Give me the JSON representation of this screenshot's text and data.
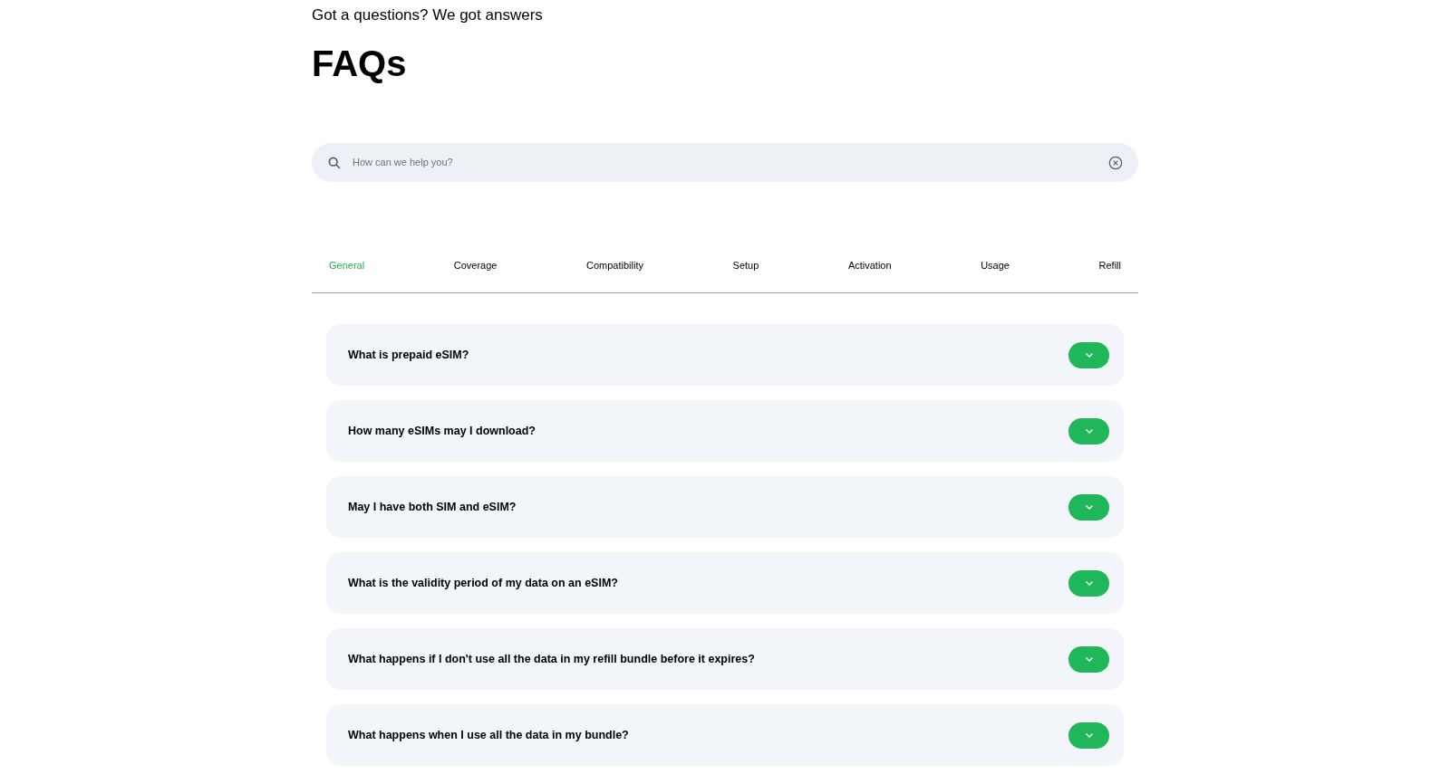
{
  "header": {
    "subtitle": "Got a questions? We got answers",
    "title": "FAQs"
  },
  "search": {
    "placeholder": "How can we help you?"
  },
  "tabs": [
    {
      "label": "General",
      "selected": true
    },
    {
      "label": "Coverage",
      "selected": false
    },
    {
      "label": "Compatibility",
      "selected": false
    },
    {
      "label": "Setup",
      "selected": false
    },
    {
      "label": "Activation",
      "selected": false
    },
    {
      "label": "Usage",
      "selected": false
    },
    {
      "label": "Refill",
      "selected": false
    }
  ],
  "faqs": [
    {
      "question": "What is prepaid eSIM?",
      "expanded": false
    },
    {
      "question": "How many eSIMs may I download?",
      "expanded": false
    },
    {
      "question": "May I have both SIM and eSIM?",
      "expanded": false
    },
    {
      "question": "What is the validity period of my data on an eSIM?",
      "expanded": false
    },
    {
      "question": "What happens if I don't use all the data in my refill bundle before it expires?",
      "expanded": false
    },
    {
      "question": "What happens when I use all the data in my bundle?",
      "expanded": false
    }
  ]
}
